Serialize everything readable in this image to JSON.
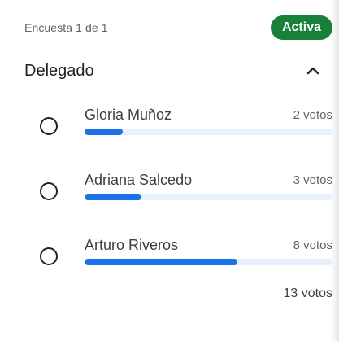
{
  "poll": {
    "counter": "Encuesta 1 de 1",
    "status": "Activa",
    "question": "Delegado",
    "collapse_icon": "chevron-up-icon",
    "total": "13 votos"
  },
  "options": [
    {
      "label": "Gloria Muñoz",
      "votes_text": "2 votos",
      "share": 0.154
    },
    {
      "label": "Adriana Salcedo",
      "votes_text": "3 votos",
      "share": 0.231
    },
    {
      "label": "Arturo Riveros",
      "votes_text": "8 votos",
      "share": 0.615
    }
  ],
  "colors": {
    "status_bg": "#188038",
    "bar_fill": "#1a73e8",
    "bar_track": "#e8f0fe"
  }
}
